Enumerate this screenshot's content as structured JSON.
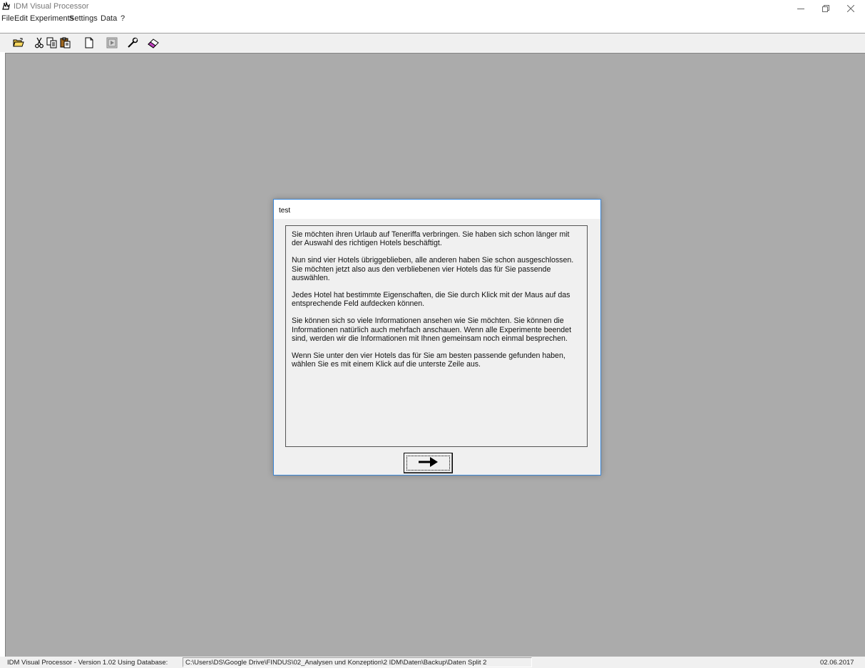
{
  "window": {
    "title": "IDM Visual Processor",
    "icon": "app-hand-icon",
    "controls": [
      "minimize-icon",
      "restore-icon",
      "close-icon"
    ]
  },
  "menu": {
    "items": [
      "File",
      "Edit",
      "Experiments",
      "Settings",
      "Data",
      "?"
    ]
  },
  "toolbar": {
    "icons": [
      "open-folder-icon",
      "cut-icon",
      "copy-icon",
      "paste-icon",
      "new-document-icon",
      "run-icon",
      "settings-wrench-icon",
      "eraser-icon"
    ]
  },
  "dialog": {
    "title": "test",
    "paragraphs": [
      "Sie möchten ihren Urlaub auf Teneriffa verbringen. Sie haben sich schon länger mit der Auswahl des richtigen Hotels beschäftigt.",
      "Nun sind vier Hotels übriggeblieben, alle anderen haben Sie schon ausgeschlossen. Sie möchten jetzt also aus den verbliebenen vier Hotels das für Sie passende auswählen.",
      "Jedes Hotel hat bestimmte Eigenschaften, die Sie durch Klick mit der Maus auf das entsprechende Feld aufdecken können.",
      "Sie können sich so viele Informationen ansehen wie Sie möchten. Sie können die Informationen natürlich auch mehrfach anschauen. Wenn alle Experimente beendet sind, werden wir die Informationen mit Ihnen gemeinsam noch einmal besprechen.",
      "Wenn Sie unter den vier Hotels das für Sie am besten passende gefunden haben, wählen Sie es mit einem Klick auf die unterste Zeile aus."
    ],
    "next_icon": "right-arrow-icon"
  },
  "status": {
    "version": "IDM Visual Processor - Version 1.02 Using Database:",
    "path": "C:\\Users\\DS\\Google Drive\\FINDUS\\02_Analysen und Konzeption\\2 IDM\\Daten\\Backup\\Daten Split 2",
    "date": "02.06.2017"
  },
  "colors": {
    "workspace": "#ababab",
    "dialog_border": "#3b86d6",
    "chrome": "#f0f0f0"
  }
}
